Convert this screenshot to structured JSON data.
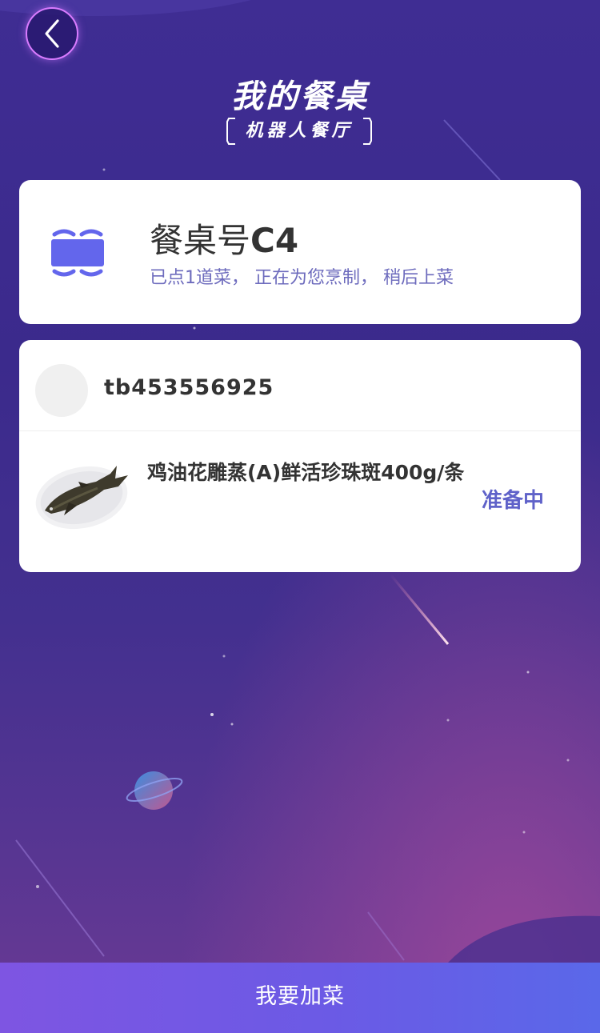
{
  "header": {
    "title": "我的餐桌",
    "subtitle": "机器人餐厅"
  },
  "table": {
    "label": "餐桌号",
    "code": "C4",
    "status": "已点1道菜， 正在为您烹制， 稍后上菜"
  },
  "order": {
    "username": "tb453556925",
    "items": [
      {
        "name": "鸡油花雕蒸(A)鲜活珍珠斑400g/条",
        "status": "准备中"
      }
    ]
  },
  "footer": {
    "add_label": "我要加菜"
  },
  "colors": {
    "accent": "#5f62c9",
    "table_icon": "#6366ec",
    "button_start": "#7e55e2",
    "button_end": "#5a68e9"
  }
}
